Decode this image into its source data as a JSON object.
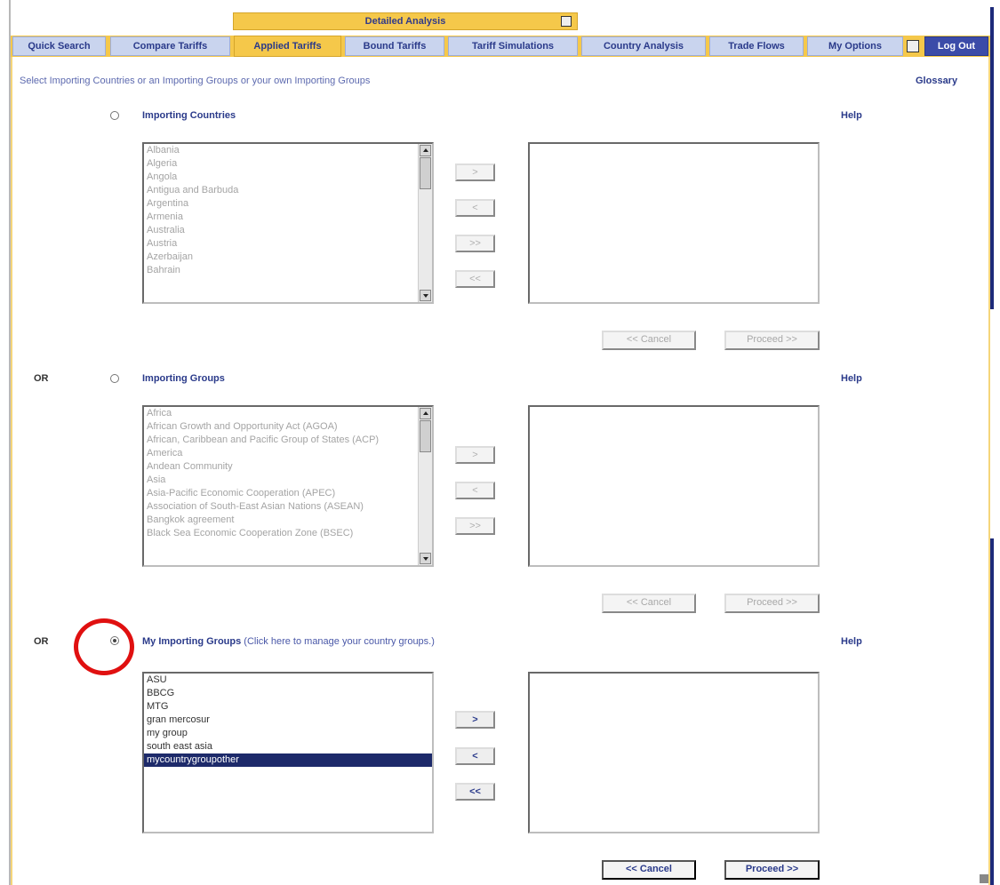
{
  "tabs": {
    "detailed_analysis": "Detailed Analysis",
    "items": [
      "Quick Search",
      "Compare Tariffs",
      "Applied Tariffs",
      "Bound Tariffs",
      "Tariff Simulations",
      "Country Analysis",
      "Trade Flows",
      "My Options",
      "Log Out"
    ]
  },
  "header": {
    "instruction": "Select Importing Countries or an Importing Groups or your own Importing Groups",
    "glossary": "Glossary"
  },
  "sections": {
    "countries": {
      "title": "Importing Countries",
      "help": "Help",
      "options": [
        "Albania",
        "Algeria",
        "Angola",
        "Antigua and Barbuda",
        "Argentina",
        "Armenia",
        "Australia",
        "Austria",
        "Azerbaijan",
        "Bahrain"
      ]
    },
    "groups": {
      "or": "OR",
      "title": "Importing Groups",
      "help": "Help",
      "options": [
        "Africa",
        "African Growth and Opportunity Act (AGOA)",
        "African, Caribbean and Pacific Group of States (ACP)",
        "America",
        "Andean Community",
        "Asia",
        "Asia-Pacific Economic Cooperation (APEC)",
        "Association of South-East Asian Nations (ASEAN)",
        "Bangkok agreement",
        "Black Sea Economic Cooperation Zone (BSEC)"
      ]
    },
    "my_groups": {
      "or": "OR",
      "title": "My Importing Groups",
      "note": "(Click here to manage your country groups.)",
      "help": "Help",
      "options": [
        "ASU",
        "BBCG",
        "MTG",
        "gran mercosur",
        "my group",
        "south east asia",
        "mycountrygroupother"
      ],
      "selected_index": 6
    }
  },
  "buttons": {
    "add": ">",
    "remove": "<",
    "add_all": ">>",
    "remove_all": "<<",
    "cancel": "<< Cancel",
    "proceed": "Proceed >>"
  }
}
